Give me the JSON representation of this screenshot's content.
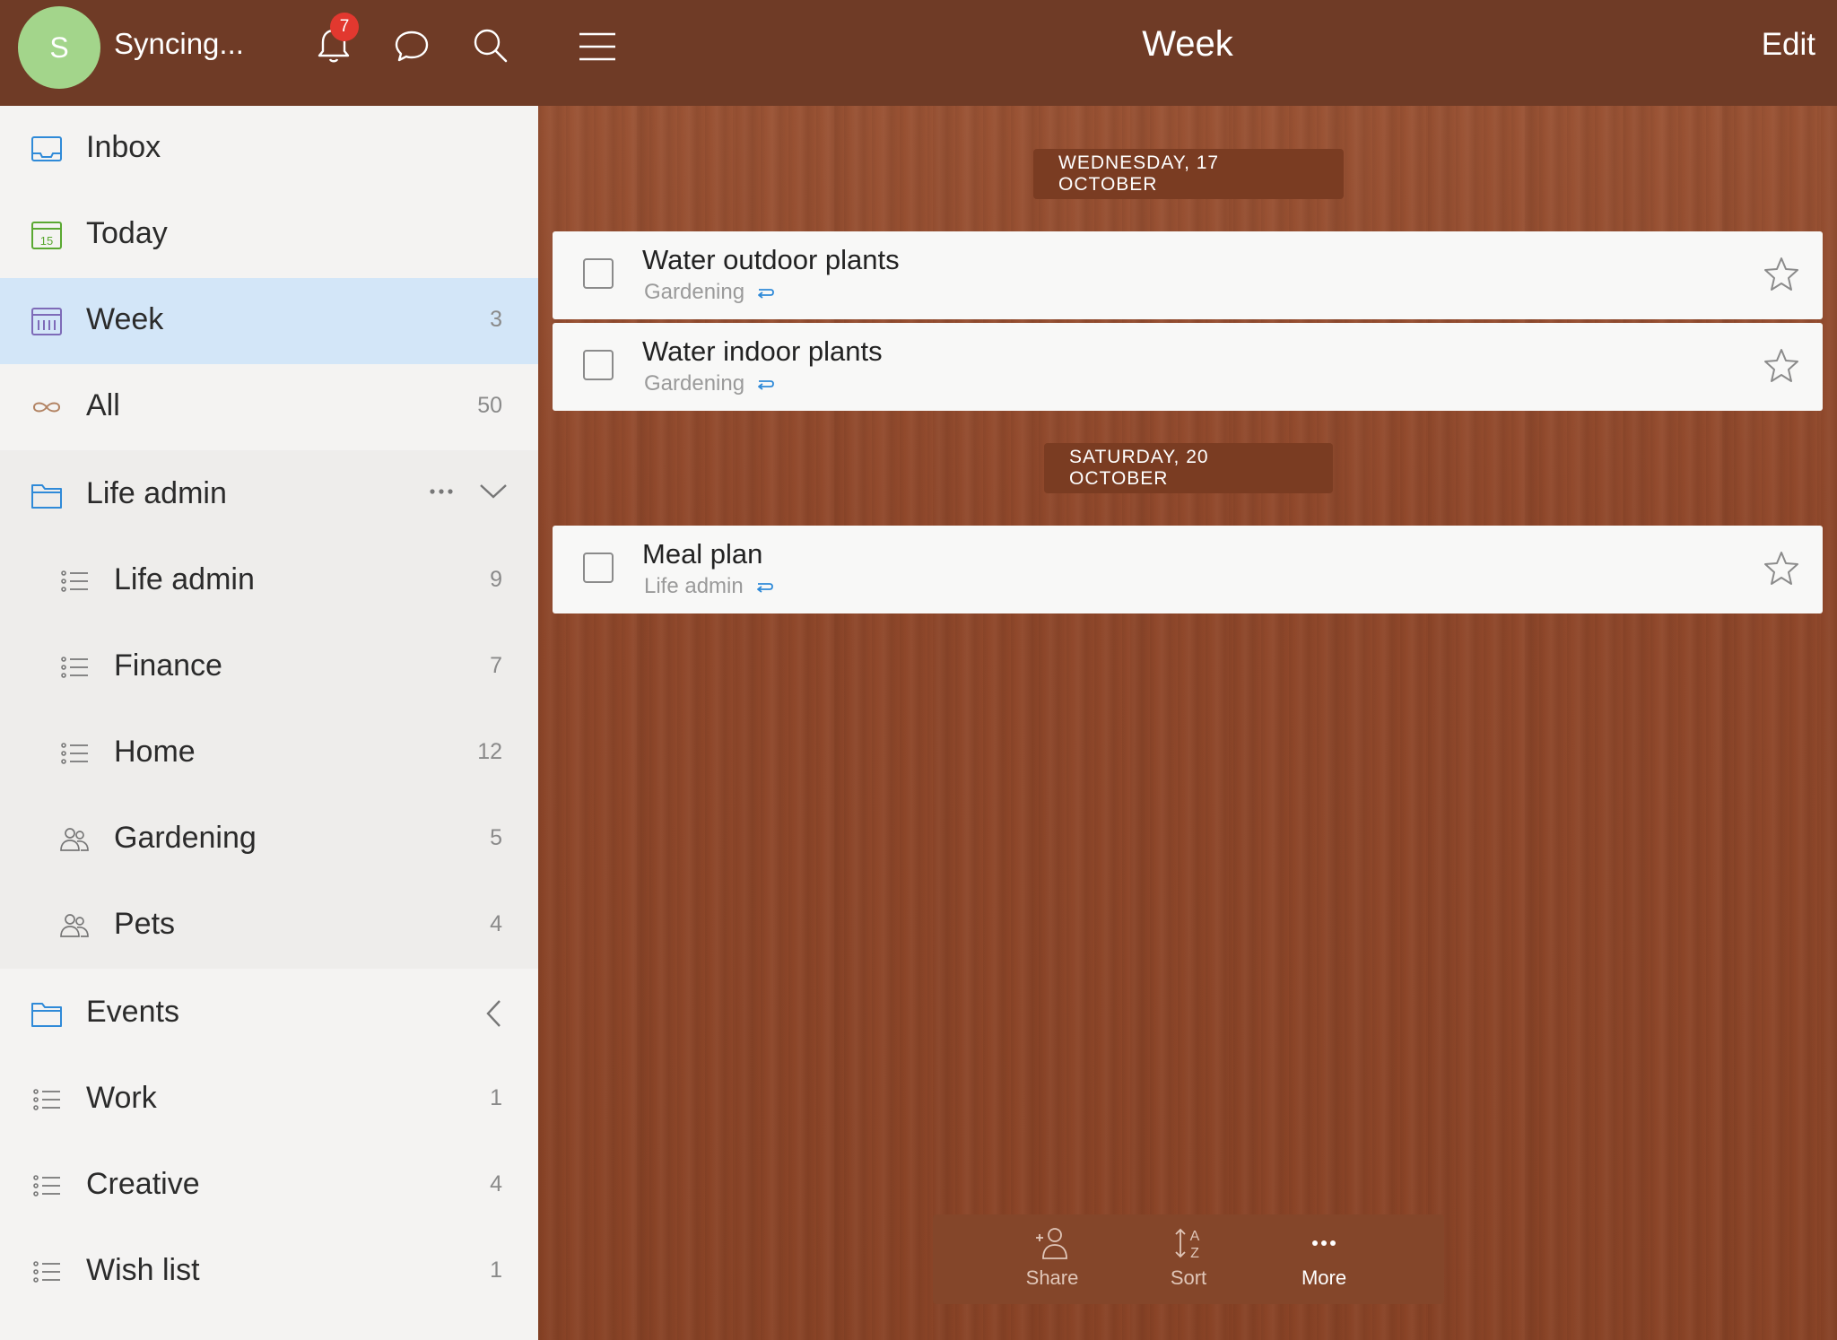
{
  "sidebar": {
    "avatar_initial": "S",
    "sync_status": "Syncing...",
    "notification_count": "7",
    "items": [
      {
        "label": "Inbox",
        "count": "",
        "icon": "inbox-icon"
      },
      {
        "label": "Today",
        "count": "",
        "icon": "calendar-today-icon",
        "day": "15"
      },
      {
        "label": "Week",
        "count": "3",
        "icon": "calendar-week-icon"
      },
      {
        "label": "All",
        "count": "50",
        "icon": "infinity-icon"
      },
      {
        "label": "Life admin",
        "count": "",
        "icon": "folder-icon"
      },
      {
        "label": "Life admin",
        "count": "9",
        "icon": "list-icon"
      },
      {
        "label": "Finance",
        "count": "7",
        "icon": "list-icon"
      },
      {
        "label": "Home",
        "count": "12",
        "icon": "list-icon"
      },
      {
        "label": "Gardening",
        "count": "5",
        "icon": "shared-list-icon"
      },
      {
        "label": "Pets",
        "count": "4",
        "icon": "shared-list-icon"
      },
      {
        "label": "Events",
        "count": "",
        "icon": "folder-icon"
      },
      {
        "label": "Work",
        "count": "1",
        "icon": "list-icon"
      },
      {
        "label": "Creative",
        "count": "4",
        "icon": "list-icon"
      },
      {
        "label": "Wish list",
        "count": "1",
        "icon": "list-icon"
      }
    ]
  },
  "main": {
    "title": "Week",
    "edit_label": "Edit",
    "groups": [
      {
        "date": "WEDNESDAY, 17 OCTOBER",
        "tasks": [
          {
            "title": "Water outdoor plants",
            "list": "Gardening"
          },
          {
            "title": "Water indoor plants",
            "list": "Gardening"
          }
        ]
      },
      {
        "date": "SATURDAY, 20 OCTOBER",
        "tasks": [
          {
            "title": "Meal plan",
            "list": "Life admin"
          }
        ]
      }
    ],
    "toolbar": {
      "share": "Share",
      "sort": "Sort",
      "more": "More"
    }
  },
  "colors": {
    "header_brown": "#6f3b26",
    "selection_blue": "#d3e6f8",
    "avatar_green": "#a3d58b",
    "badge_red": "#e2382f",
    "icon_blue": "#2f8ad8"
  }
}
